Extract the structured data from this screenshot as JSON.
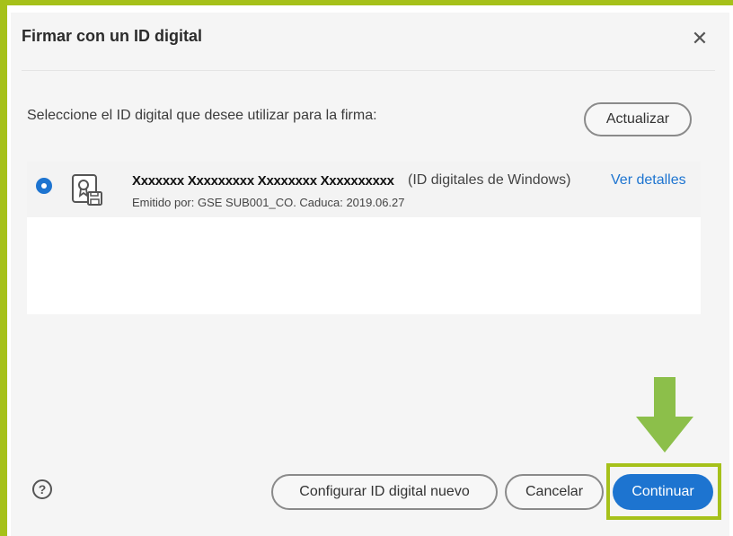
{
  "dialog": {
    "title": "Firmar con un ID digital",
    "close_label": "✕"
  },
  "instruction": "Seleccione el ID digital que desee utilizar para la firma:",
  "refresh_label": "Actualizar",
  "digital_ids": [
    {
      "name": "Xxxxxxx Xxxxxxxxx Xxxxxxxx Xxxxxxxxxx",
      "type": "(ID digitales de Windows)",
      "details_link": "Ver detalles",
      "issued_line": "Emitido por: GSE SUB001_CO. Caduca: 2019.06.27",
      "selected": true,
      "icon": "certificate-icon"
    }
  ],
  "footer": {
    "help_label": "?",
    "new_id_label": "Configurar ID digital nuevo",
    "cancel_label": "Cancelar",
    "continue_label": "Continuar"
  },
  "colors": {
    "accent": "#1d74d0",
    "highlight": "#a6c11a",
    "arrow": "#8cbf4a"
  }
}
